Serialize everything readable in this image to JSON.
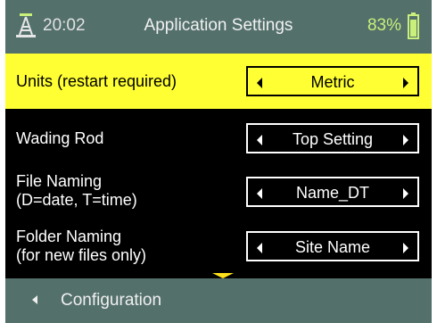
{
  "status": {
    "time": "20:02",
    "title": "Application Settings",
    "battery": "83%",
    "signal_icon": "tower-icon",
    "battery_icon": "battery-icon"
  },
  "settings": [
    {
      "label_lines": [
        "Units (restart required)"
      ],
      "value": "Metric",
      "selected": true
    },
    {
      "label_lines": [
        "Wading Rod"
      ],
      "value": "Top Setting",
      "selected": false
    },
    {
      "label_lines": [
        "File Naming",
        "(D=date, T=time)"
      ],
      "value": "Name_DT",
      "selected": false
    },
    {
      "label_lines": [
        "Folder Naming",
        "(for new files only)"
      ],
      "value": "Site Name",
      "selected": false
    }
  ],
  "footer": {
    "back_label": "Configuration"
  },
  "colors": {
    "bar": "#53706b",
    "highlight": "#ffff33",
    "battery_text": "#c9f07a",
    "scroll_arrow": "#ffe11a"
  }
}
